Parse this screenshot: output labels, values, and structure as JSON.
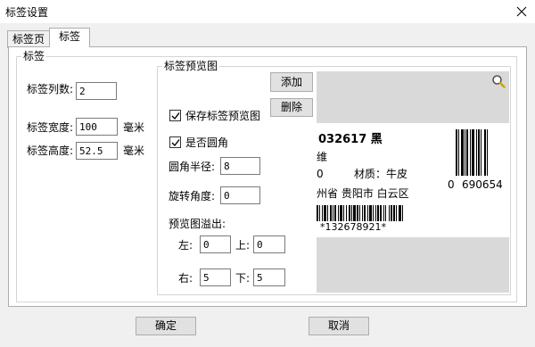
{
  "window": {
    "title": "标签设置"
  },
  "tabs": [
    {
      "label": "标签页"
    },
    {
      "label": "标签"
    }
  ],
  "label_group": {
    "title": "标签",
    "columns": {
      "label": "标签列数:",
      "value": "2"
    },
    "width": {
      "label": "标签宽度:",
      "value": "100",
      "unit": "毫米"
    },
    "height": {
      "label": "标签高度:",
      "value": "52.5",
      "unit": "毫米"
    }
  },
  "preview_group": {
    "title": "标签预览图",
    "add_button": "添加",
    "delete_button": "删除",
    "save_preview": {
      "label": "保存标签预览图",
      "checked": true
    },
    "rounded": {
      "label": "是否圆角",
      "checked": true
    },
    "corner_radius": {
      "label": "圆角半径:",
      "value": "8"
    },
    "rotation": {
      "label": "旋转角度:",
      "value": "0"
    },
    "overflow": {
      "label": "预览图溢出:",
      "left": {
        "label": "左:",
        "value": "0"
      },
      "top": {
        "label": "上:",
        "value": "0"
      },
      "right": {
        "label": "右:",
        "value": "5"
      },
      "bottom": {
        "label": "下:",
        "value": "5"
      }
    }
  },
  "preview_image": {
    "line1": "032617  黑",
    "line2": "维",
    "line3_prefix": "0",
    "line3": "材质：牛皮",
    "line4": "州省  贵阳市  白云区",
    "barcode_text": "*132678921*",
    "barcode_digits_left": "0",
    "barcode_digits_right": "690654",
    "zoom_icon": "magnifier-icon"
  },
  "footer": {
    "ok_button": "确定",
    "cancel_button": "取消"
  }
}
